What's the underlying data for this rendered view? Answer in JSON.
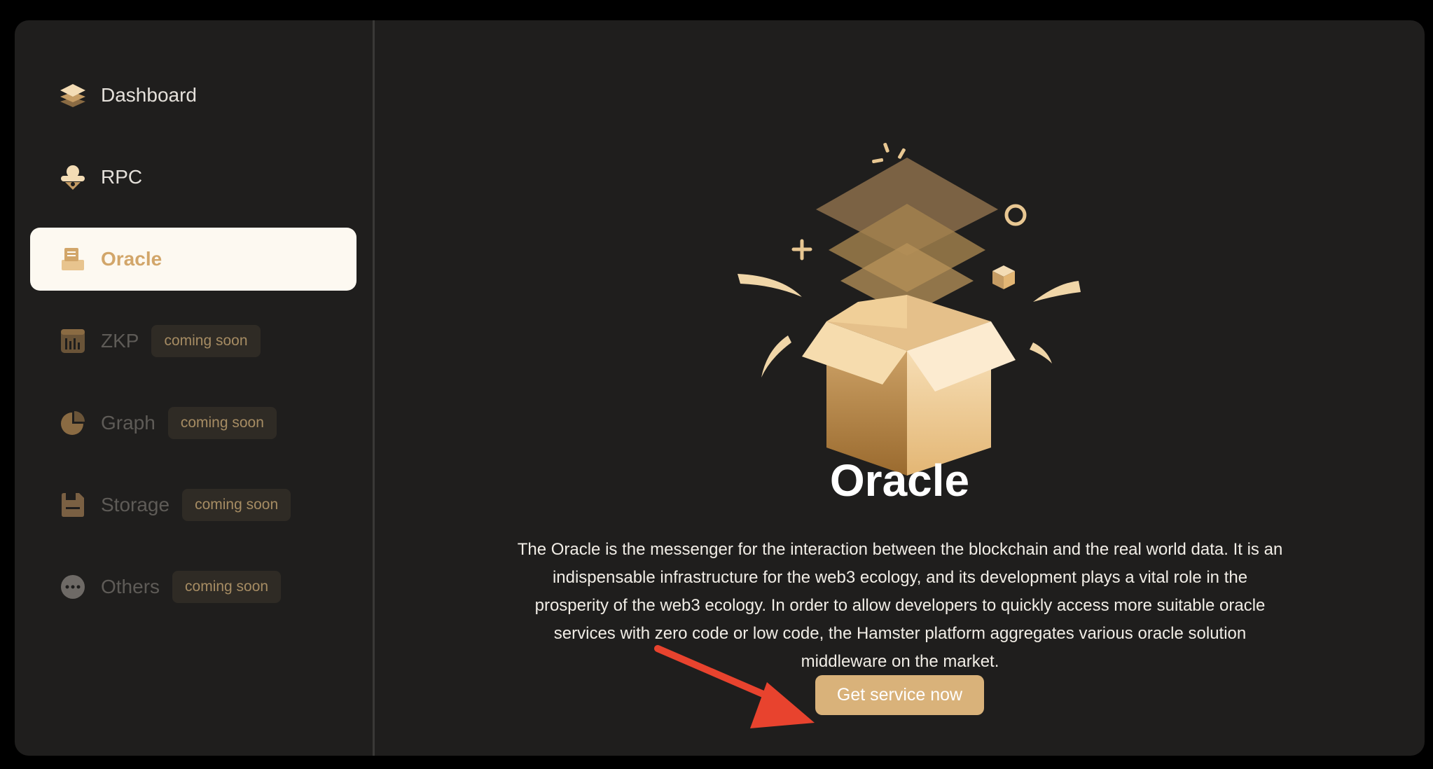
{
  "sidebar": {
    "items": [
      {
        "label": "Dashboard",
        "icon": "layers-icon"
      },
      {
        "label": "RPC",
        "icon": "rpc-icon"
      },
      {
        "label": "Oracle",
        "icon": "oracle-icon",
        "active": true
      },
      {
        "label": "ZKP",
        "icon": "zkp-icon",
        "badge": "coming soon"
      },
      {
        "label": "Graph",
        "icon": "pie-chart-icon",
        "badge": "coming soon"
      },
      {
        "label": "Storage",
        "icon": "storage-icon",
        "badge": "coming soon"
      },
      {
        "label": "Others",
        "icon": "more-icon",
        "badge": "coming soon"
      }
    ]
  },
  "main": {
    "title": "Oracle",
    "description": "The Oracle is the messenger for the interaction between the blockchain and the real world data. It is an indispensable infrastructure for the web3 ecology, and its development plays a vital role in the prosperity of the web3 ecology. In order to allow developers to quickly access more suitable oracle services with zero code or low code, the Hamster platform aggregates various oracle solution middleware on the market.",
    "cta_label": "Get service now",
    "illustration": "open-box-illustration",
    "annotation": "red-arrow-pointing-to-button"
  },
  "colors": {
    "background": "#1f1e1d",
    "accent": "#d9b27a",
    "active_bg": "#fdf9f1",
    "badge_bg": "#2f2b25",
    "badge_text": "#a68c63",
    "arrow": "#e8432e"
  }
}
